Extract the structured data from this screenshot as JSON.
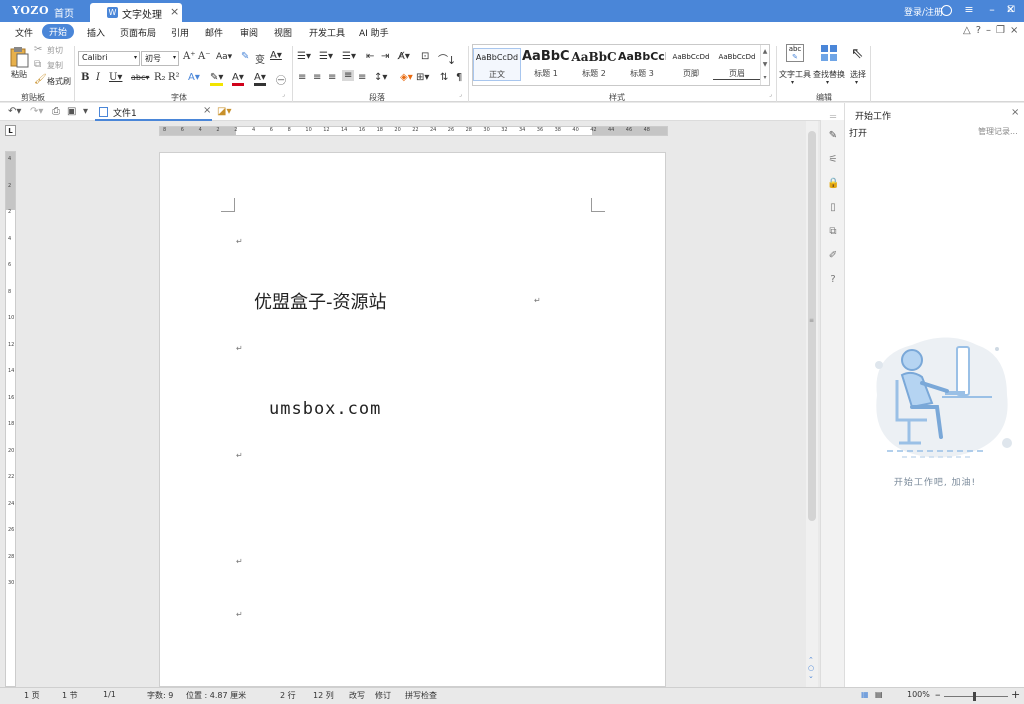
{
  "app": {
    "logo": "YOZO",
    "home": "首页",
    "doc_tab": "文字处理",
    "login": "登录/注册"
  },
  "menu": [
    "文件",
    "开始",
    "插入",
    "页面布局",
    "引用",
    "邮件",
    "审阅",
    "视图",
    "开发工具",
    "AI 助手"
  ],
  "menu_active": "开始",
  "ribbon": {
    "clipboard": {
      "paste": "粘贴",
      "cut": "剪切",
      "copy": "复制",
      "format_painter": "格式刷",
      "label": "剪贴板"
    },
    "font": {
      "family": "Calibri",
      "size": "初号",
      "label": "字体"
    },
    "paragraph": {
      "label": "段落"
    },
    "styles": {
      "label": "样式",
      "items": [
        {
          "sample": "AaBbCcDd",
          "name": "正文"
        },
        {
          "sample": "AaBbCc",
          "name": "标题 1"
        },
        {
          "sample": "AaBbC",
          "name": "标题 2"
        },
        {
          "sample": "AaBbCcI",
          "name": "标题 3"
        },
        {
          "sample": "AaBbCcDd",
          "name": "页脚"
        },
        {
          "sample": "AaBbCcDd",
          "name": "页眉"
        }
      ]
    },
    "editing": {
      "label": "编辑",
      "text_tools": "文字工具",
      "find_replace": "查找替换",
      "select": "选择"
    }
  },
  "quickbar": {
    "file_tab": "文件1"
  },
  "document": {
    "heading": "优盟盒子-资源站",
    "url": "umsbox.com",
    "para_mark": "↵"
  },
  "ruler": {
    "h_ticks": [
      "8",
      "6",
      "4",
      "2",
      "2",
      "4",
      "6",
      "8",
      "10",
      "12",
      "14",
      "16",
      "18",
      "20",
      "22",
      "24",
      "26",
      "28",
      "30",
      "32",
      "34",
      "36",
      "38",
      "40",
      "42",
      "44",
      "46",
      "48"
    ],
    "v_ticks": [
      "4",
      "2",
      "2",
      "4",
      "6",
      "8",
      "10",
      "12",
      "14",
      "16",
      "18",
      "20",
      "22",
      "24",
      "26",
      "28",
      "30"
    ],
    "corner": "L"
  },
  "sidepanel": {
    "title": "开始工作",
    "open": "打开",
    "manage": "管理记录...",
    "cheer": "开始工作吧, 加油!"
  },
  "status": {
    "page": "1 页",
    "section": "1 节",
    "pages": "1/1",
    "words": "字数: 9",
    "position": "位置 : 4.87 厘米",
    "row": "2 行",
    "col": "12 列",
    "overwrite": "改写",
    "revise": "修订",
    "spell": "拼写检查",
    "zoom": "100%"
  }
}
